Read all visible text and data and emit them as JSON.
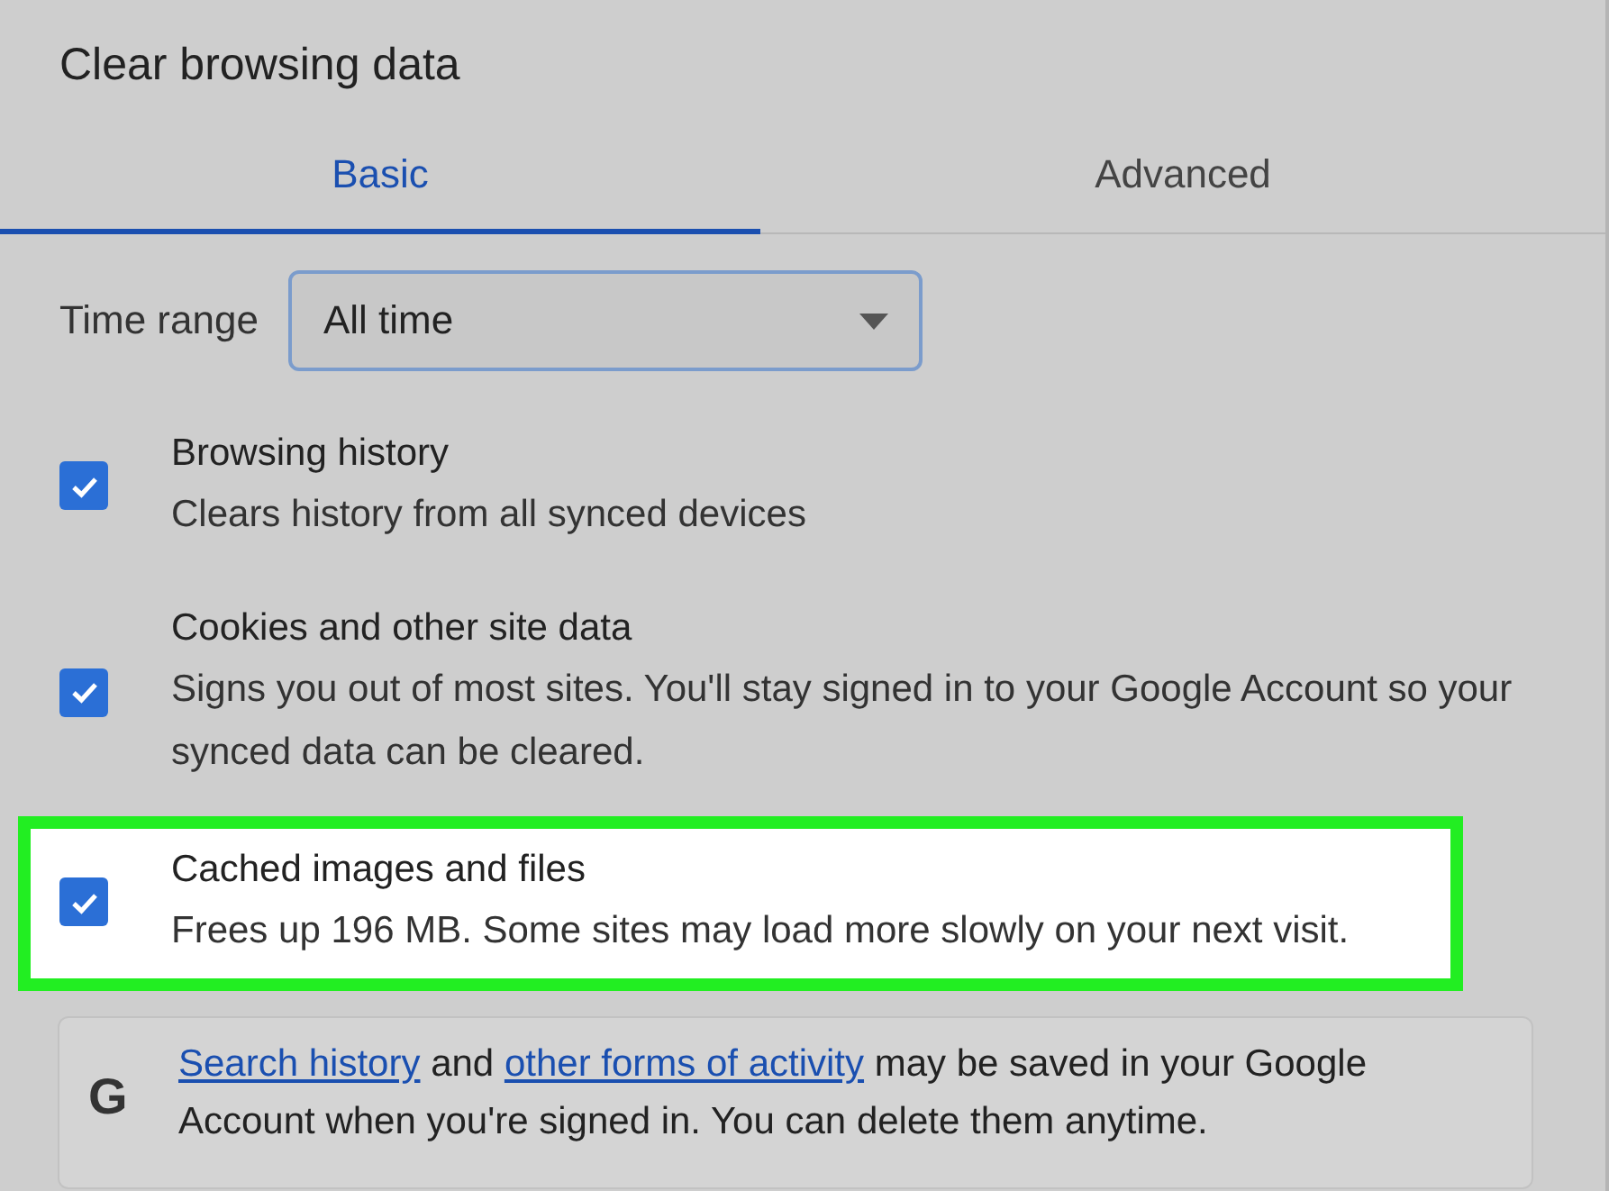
{
  "dialog": {
    "title": "Clear browsing data"
  },
  "tabs": [
    {
      "label": "Basic",
      "selected": true
    },
    {
      "label": "Advanced",
      "selected": false
    }
  ],
  "time_range": {
    "label": "Time range",
    "value": "All time"
  },
  "items": [
    {
      "title": "Browsing history",
      "description": "Clears history from all synced devices",
      "checked": true,
      "highlighted": false
    },
    {
      "title": "Cookies and other site data",
      "description": "Signs you out of most sites. You'll stay signed in to your Google Account so your synced data can be cleared.",
      "checked": true,
      "highlighted": false
    },
    {
      "title": "Cached images and files",
      "description": "Frees up 196 MB. Some sites may load more slowly on your next visit.",
      "checked": true,
      "highlighted": true
    }
  ],
  "notice": {
    "logo": "G",
    "parts": [
      {
        "kind": "link",
        "text": "Search history"
      },
      {
        "kind": "text",
        "text": " and "
      },
      {
        "kind": "link",
        "text": "other forms of activity"
      },
      {
        "kind": "text",
        "text": " may be saved in your Google Account when you're signed in. You can delete them anytime."
      }
    ]
  }
}
